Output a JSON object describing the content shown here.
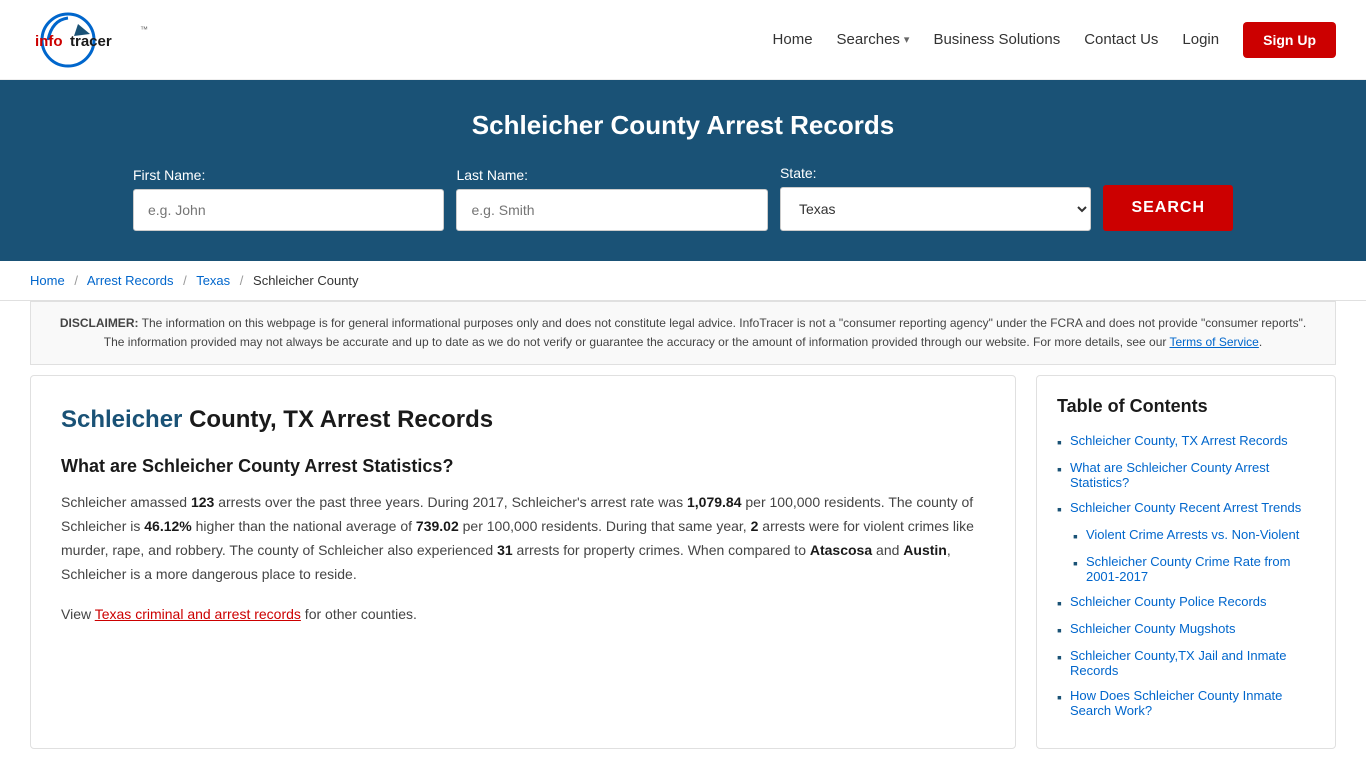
{
  "header": {
    "logo_text": "infotracer",
    "nav": {
      "home": "Home",
      "searches": "Searches",
      "business_solutions": "Business Solutions",
      "contact_us": "Contact Us",
      "login": "Login",
      "signup": "Sign Up"
    }
  },
  "hero": {
    "title": "Schleicher County Arrest Records",
    "form": {
      "first_name_label": "First Name:",
      "first_name_placeholder": "e.g. John",
      "last_name_label": "Last Name:",
      "last_name_placeholder": "e.g. Smith",
      "state_label": "State:",
      "state_value": "Texas",
      "search_button": "SEARCH"
    }
  },
  "breadcrumb": {
    "home": "Home",
    "arrest_records": "Arrest Records",
    "texas": "Texas",
    "current": "Schleicher County"
  },
  "disclaimer": {
    "text_before_bold": "",
    "bold_label": "DISCLAIMER:",
    "text": " The information on this webpage is for general informational purposes only and does not constitute legal advice. InfoTracer is not a \"consumer reporting agency\" under the FCRA and does not provide \"consumer reports\". The information provided may not always be accurate and up to date as we do not verify or guarantee the accuracy or the amount of information provided through our website. For more details, see our",
    "link_text": "Terms of Service",
    "text_after": "."
  },
  "article": {
    "title_highlight": "Schleicher",
    "title_rest": " County, TX Arrest Records",
    "section1_heading": "What are Schleicher County Arrest Statistics?",
    "section1_p1": "Schleicher amassed 123 arrests over the past three years. During 2017, Schleicher's arrest rate was 1,079.84 per 100,000 residents. The county of Schleicher is 46.12% higher than the national average of 739.02 per 100,000 residents. During that same year, 2 arrests were for violent crimes like murder, rape, and robbery. The county of Schleicher also experienced 31 arrests for property crimes. When compared to Atascosa and Austin, Schleicher is a more dangerous place to reside.",
    "section1_p2_prefix": "View ",
    "section1_p2_link": "Texas criminal and arrest records",
    "section1_p2_suffix": " for other counties.",
    "arrests_count": "123",
    "arrest_rate": "1,079.84",
    "higher_percent": "46.12%",
    "national_avg": "739.02",
    "violent_arrests": "2",
    "property_arrests": "31",
    "compare_county1": "Atascosa",
    "compare_county2": "Austin"
  },
  "toc": {
    "title": "Table of Contents",
    "items": [
      {
        "label": "Schleicher County, TX Arrest Records",
        "indent": false
      },
      {
        "label": "What are Schleicher County Arrest Statistics?",
        "indent": false
      },
      {
        "label": "Schleicher County Recent Arrest Trends",
        "indent": false
      },
      {
        "label": "Violent Crime Arrests vs. Non-Violent",
        "indent": true
      },
      {
        "label": "Schleicher County Crime Rate from 2001-2017",
        "indent": true
      },
      {
        "label": "Schleicher County Police Records",
        "indent": false
      },
      {
        "label": "Schleicher County Mugshots",
        "indent": false
      },
      {
        "label": "Schleicher County,TX Jail and Inmate Records",
        "indent": false
      },
      {
        "label": "How Does Schleicher County Inmate Search Work?",
        "indent": false
      }
    ]
  }
}
